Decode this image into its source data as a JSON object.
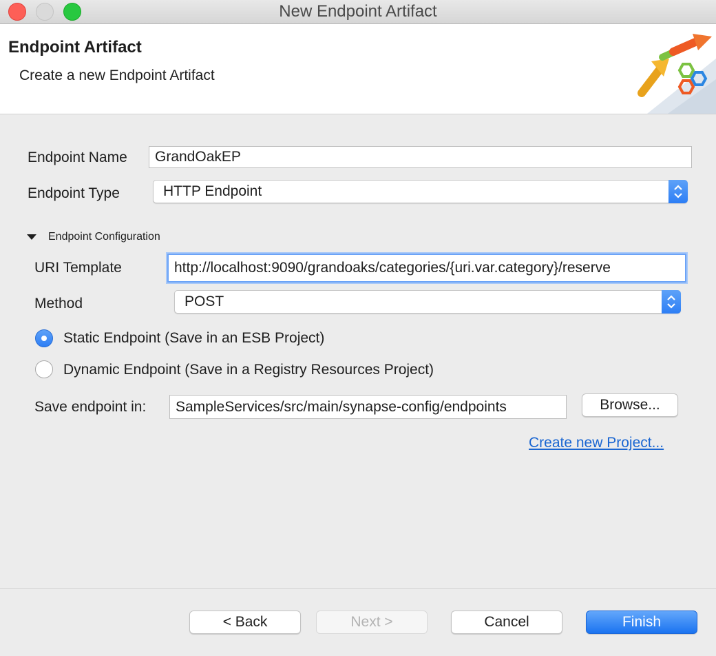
{
  "window": {
    "title": "New Endpoint Artifact"
  },
  "banner": {
    "title": "Endpoint Artifact",
    "description": "Create a new Endpoint Artifact"
  },
  "form": {
    "endpoint_name_label": "Endpoint Name",
    "endpoint_name_value": "GrandOakEP",
    "endpoint_type_label": "Endpoint Type",
    "endpoint_type_value": "HTTP Endpoint"
  },
  "config": {
    "section_label": "Endpoint Configuration",
    "uri_label": "URI Template",
    "uri_value": "http://localhost:9090/grandoaks/categories/{uri.var.category}/reserve",
    "method_label": "Method",
    "method_value": "POST",
    "static_label": "Static Endpoint (Save in an ESB Project)",
    "dynamic_label": "Dynamic Endpoint (Save in a Registry Resources Project)",
    "selected_option": "static",
    "save_label": "Save endpoint in:",
    "save_value": "SampleServices/src/main/synapse-config/endpoints",
    "browse_label": "Browse...",
    "create_project_link": "Create new Project..."
  },
  "footer": {
    "back": "< Back",
    "next": "Next >",
    "cancel": "Cancel",
    "finish": "Finish"
  },
  "colors": {
    "accent": "#2d7ef5",
    "link": "#1a66d2",
    "focus_ring": "#6ba3f7"
  }
}
